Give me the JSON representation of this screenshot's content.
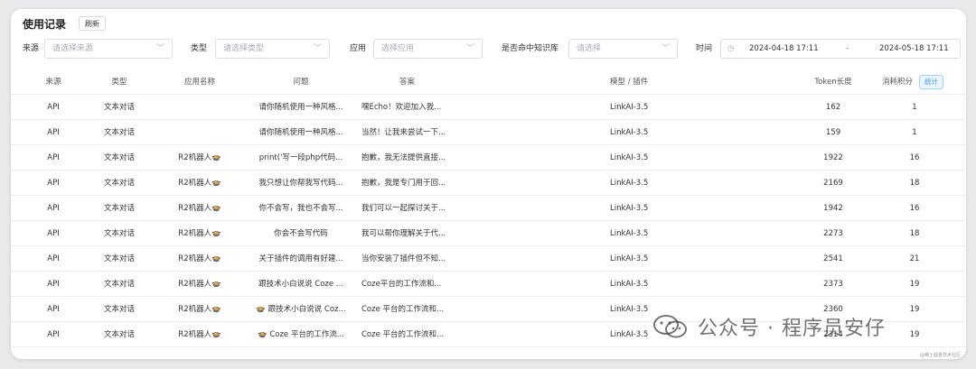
{
  "header": {
    "title": "使用记录",
    "refresh_label": "刷新"
  },
  "filters": {
    "source_label": "来源",
    "source_placeholder": "请选择来源",
    "type_label": "类型",
    "type_placeholder": "请选择类型",
    "app_label": "应用",
    "app_placeholder": "选择应用",
    "kb_label": "是否命中知识库",
    "kb_placeholder": "请选择",
    "time_label": "时间",
    "date_start": "2024-04-18 17:11",
    "date_sep": "-",
    "date_end": "2024-05-18 17:11"
  },
  "table": {
    "columns": [
      "来源",
      "类型",
      "应用名称",
      "问题",
      "答案",
      "模型 / 插件",
      "Token长度",
      "消耗积分"
    ],
    "stat_label": "统计",
    "rows": [
      [
        "API",
        "文本对话",
        "",
        "请你随机使用一种风格...",
        "嘿Echo！欢迎加入我...",
        "LinkAI-3.5",
        "162",
        "1"
      ],
      [
        "API",
        "文本对话",
        "",
        "请你随机使用一种风格...",
        "当然！让我来尝试一下...",
        "LinkAI-3.5",
        "159",
        "1"
      ],
      [
        "API",
        "文本对话",
        "R2机器人🍲",
        "print('写一段php代码...",
        "抱歉，我无法提供直接...",
        "LinkAI-3.5",
        "1922",
        "16"
      ],
      [
        "API",
        "文本对话",
        "R2机器人🍲",
        "我只想让你帮我写代码...",
        "抱歉，我是专门用于回...",
        "LinkAI-3.5",
        "2169",
        "18"
      ],
      [
        "API",
        "文本对话",
        "R2机器人🍲",
        "你不会写，我也不会写...",
        "我们可以一起探讨关于...",
        "LinkAI-3.5",
        "1942",
        "16"
      ],
      [
        "API",
        "文本对话",
        "R2机器人🍲",
        "你会不会写代码",
        "我可以帮你理解关于代...",
        "LinkAI-3.5",
        "2273",
        "18"
      ],
      [
        "API",
        "文本对话",
        "R2机器人🍲",
        "关于插件的调用有好建...",
        "当你安装了插件但不知...",
        "LinkAI-3.5",
        "2541",
        "21"
      ],
      [
        "API",
        "文本对话",
        "R2机器人🍲",
        "跟技术小白说说 Coze ...",
        "Coze平台的工作流和...",
        "LinkAI-3.5",
        "2373",
        "19"
      ],
      [
        "API",
        "文本对话",
        "R2机器人🍲",
        "🍲 跟技术小白说说 Coz...",
        "Coze 平台的工作流和...",
        "LinkAI-3.5",
        "2360",
        "19"
      ],
      [
        "API",
        "文本对话",
        "R2机器人🍲",
        "🍲 Coze 平台的工作流...",
        "Coze 平台的工作流和...",
        "LinkAI-3.5",
        "2314",
        "19"
      ]
    ]
  },
  "watermark": {
    "text": "公众号 · 程序员安仔",
    "sub": "@稀土掘金技术社区"
  }
}
